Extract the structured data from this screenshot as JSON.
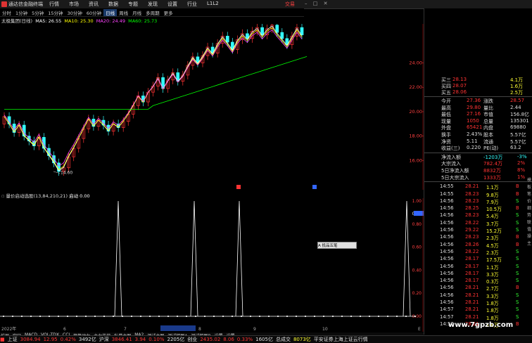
{
  "window": {
    "app_title": "通达信金融终端",
    "menu": [
      "行情",
      "市场",
      "资讯",
      "数据",
      "专题",
      "发现",
      "设置",
      "行业",
      "L1L2"
    ],
    "brand": "交易",
    "controls": "– □ ✕"
  },
  "period_tabs": [
    "分时",
    "1分钟",
    "5分钟",
    "15分钟",
    "30分钟",
    "60分钟",
    "日线",
    "周线",
    "月线",
    "多周期",
    "更多"
  ],
  "active_period": "日线",
  "stock_line": {
    "name": "太极集团(日线)",
    "ma5": "MA5: 26.55",
    "ma10": "MA10: 25.30",
    "ma20": "MA20: 24.49",
    "ma60": "MA60: 25.73"
  },
  "price_axis": [
    "24.00",
    "22.00",
    "20.00",
    "18.00",
    "16.00"
  ],
  "low_label": "14.60",
  "date_axis": [
    "2022年",
    "6",
    "7",
    "2022/06/17/五",
    "8",
    "9",
    "10"
  ],
  "date_end": "E",
  "indicator": {
    "header": "量价启动选股(13,84,210,21)",
    "start_label": "启动",
    "start_value": "0.00",
    "axis": [
      "1.00",
      "0.89",
      "0.80",
      "0.60",
      "0.40",
      "0.20",
      "0.00"
    ]
  },
  "float_button": "A 抵品五笔",
  "bottom_tabs_row1": [
    "扩展",
    "窗口",
    "MACD",
    "VOL-TDX",
    "CCI",
    "趋势动力",
    "主力监控",
    "私募主图",
    "MA2",
    "测试主图",
    "测试幅图A",
    "测试幅图B",
    "设置",
    "设置"
  ],
  "bottom_tabs_row2": [
    "扩展",
    "关联报价",
    "资金分布",
    "综合资讯",
    "行业资讯",
    "互动问答",
    "前商户福利专享"
  ],
  "right_sidebar_tabs": [
    "模板",
    "笔",
    "价",
    "细",
    "势",
    "联",
    "值",
    "操",
    "主"
  ],
  "right_top_rows": [
    {
      "label": "买三",
      "price": "28.13",
      "vol": "",
      "amt": "4.1万",
      "color": "red"
    },
    {
      "label": "买四",
      "price": "28.07",
      "vol": "",
      "amt": "1.6万",
      "color": "red"
    },
    {
      "label": "买五",
      "price": "28.06",
      "vol": "",
      "amt": "2.5万",
      "color": "red"
    }
  ],
  "quote_rows": [
    {
      "l1": "今开",
      "v1": "27.36",
      "l2": "涨跌",
      "v2": "28.57"
    },
    {
      "l1": "最高",
      "v1": "29.80",
      "l2": "量比",
      "v2": "2.44"
    },
    {
      "l1": "最低",
      "v1": "27.16",
      "l2": "市值",
      "v2": "156.8亿"
    },
    {
      "l1": "现量",
      "v1": "1050",
      "l2": "总量",
      "v2": "135301"
    },
    {
      "l1": "外盘",
      "v1": "65421",
      "l2": "内盘",
      "v2": "69880"
    },
    {
      "l1": "换手",
      "v1": "2.43%",
      "l2": "股本",
      "v2": "5.57亿"
    },
    {
      "l1": "净资",
      "v1": "5.11",
      "l2": "流通",
      "v2": "5.57亿"
    },
    {
      "l1": "收益(三)",
      "v1": "0.220",
      "l2": "PE(动)",
      "v2": "63.2"
    }
  ],
  "flow_rows": [
    {
      "label": "净流入额",
      "value": "-1203万",
      "pct": "-3%"
    },
    {
      "label": "大宗流入",
      "value": "782.4万",
      "pct": "2%"
    },
    {
      "label": "5日净流入额",
      "value": "8832万",
      "pct": "8%"
    },
    {
      "label": "5日大宗流入",
      "value": "1333万",
      "pct": "1%"
    }
  ],
  "ticks": [
    {
      "t": "14:55",
      "p": "28.21",
      "v": "1.1万",
      "d": "B"
    },
    {
      "t": "14:55",
      "p": "28.23",
      "v": "9.8万",
      "d": "B"
    },
    {
      "t": "14:56",
      "p": "28.23",
      "v": "7.9万",
      "d": "S"
    },
    {
      "t": "14:56",
      "p": "28.25",
      "v": "10.5万",
      "d": "B"
    },
    {
      "t": "14:56",
      "p": "28.23",
      "v": "5.4万",
      "d": "S"
    },
    {
      "t": "14:56",
      "p": "28.22",
      "v": "3.7万",
      "d": "S"
    },
    {
      "t": "14:56",
      "p": "29.22",
      "v": "15.2万",
      "d": "S"
    },
    {
      "t": "14:56",
      "p": "28.23",
      "v": "2.3万",
      "d": "B"
    },
    {
      "t": "14:56",
      "p": "28.26",
      "v": "4.5万",
      "d": "B"
    },
    {
      "t": "14:56",
      "p": "28.22",
      "v": "2.3万",
      "d": "S"
    },
    {
      "t": "14:56",
      "p": "28.17",
      "v": "17.5万",
      "d": "S"
    },
    {
      "t": "14:56",
      "p": "28.17",
      "v": "1.1万",
      "d": "S"
    },
    {
      "t": "14:56",
      "p": "28.17",
      "v": "3.3万",
      "d": "S"
    },
    {
      "t": "14:56",
      "p": "28.17",
      "v": "0.3万",
      "d": "S"
    },
    {
      "t": "14:56",
      "p": "28.21",
      "v": "2.7万",
      "d": "B"
    },
    {
      "t": "14:56",
      "p": "28.21",
      "v": "3.3万",
      "d": "S"
    },
    {
      "t": "14:56",
      "p": "28.21",
      "v": "1.8万",
      "d": "S"
    },
    {
      "t": "14:57",
      "p": "28.21",
      "v": "1.8万",
      "d": "S"
    },
    {
      "t": "14:57",
      "p": "28.21",
      "v": "1.8万",
      "d": "S"
    },
    {
      "t": "14:57",
      "p": "28.21",
      "v": "1.8万",
      "d": "B"
    }
  ],
  "status": {
    "sh_label": "上证",
    "sh_val": "3084.94",
    "sh_chg": "12.95",
    "sh_pct": "0.42%",
    "sh_amt": "3492亿",
    "sz_label": "沪深",
    "sz_val": "3846.41",
    "sz_chg": "3.94",
    "sz_pct": "0.10%",
    "sz_amt": "2205亿",
    "cy_label": "创业",
    "cy_val": "2435.02",
    "cy_chg": "8.06",
    "cy_pct": "0.33%",
    "cy_amt": "1605亿",
    "total_label": "总成交",
    "total_val": "8073亿",
    "server": "平安证券上海上证云行情"
  },
  "watermark": "www.7gpzb.com",
  "colors": {
    "up": "#ff3333",
    "down": "#33ffff",
    "ma5": "#ffffff",
    "ma10": "#ffff00",
    "ma20": "#ff44ff",
    "ma60": "#00ff00"
  }
}
